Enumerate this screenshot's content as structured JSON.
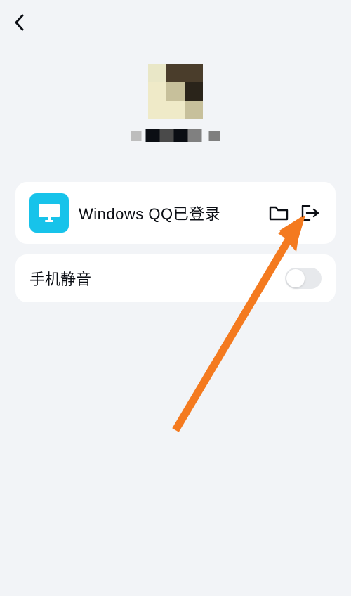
{
  "nav": {
    "back": "back"
  },
  "profile": {
    "nickname_censored": true
  },
  "device": {
    "status_label": "Windows QQ已登录",
    "icon": "monitor",
    "actions": {
      "folder": "folder",
      "logout": "logout"
    }
  },
  "mute": {
    "label": "手机静音",
    "state": "off"
  },
  "avatar_pixels": {
    "r0": [
      "#e9e7c7",
      "#4a3d2b",
      "#4a3d2b"
    ],
    "r1": [
      "#efeac8",
      "#c7c09b",
      "#2a241a"
    ],
    "r2": [
      "#efeac8",
      "#efeac8",
      "#c7c09b"
    ]
  },
  "accent": {
    "device_icon_bg": "#17c3ea",
    "arrow": "#f47a1f"
  }
}
